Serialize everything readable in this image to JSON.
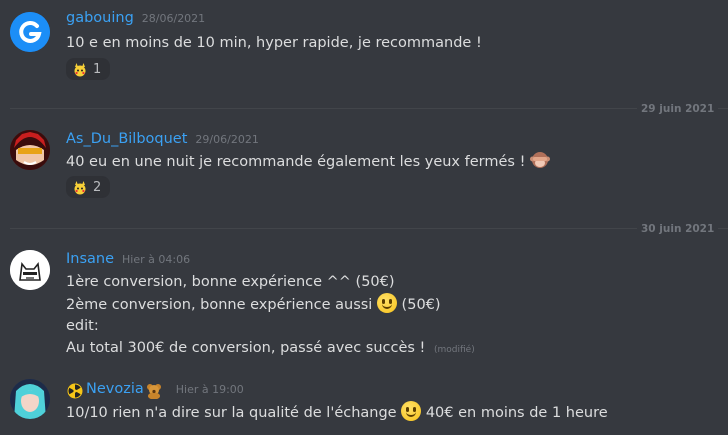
{
  "messages": [
    {
      "username": "gabouing",
      "timestamp": "28/06/2021",
      "user_color": "#3ba1f3",
      "lines": [
        "10 e en moins de 10 min, hyper rapide, je recommande !"
      ],
      "reaction": {
        "emoji": "pikachu-icon",
        "count": "1"
      }
    },
    {
      "username": "As_Du_Bilboquet",
      "timestamp": "29/06/2021",
      "user_color": "#3ba1f3",
      "lines": [
        "40 eu en une nuit  je recommande également les yeux fermés !"
      ],
      "reaction": {
        "emoji": "pikachu-icon",
        "count": "2"
      }
    },
    {
      "username": "Insane",
      "timestamp": "Hier à 04:06",
      "user_color": "#3ba1f3",
      "lines": [
        "1ère conversion, bonne expérience ^^ (50€)",
        "2ème conversion, bonne expérience aussi",
        " (50€)",
        "edit:",
        "Au total 300€ de conversion, passé avec succès !"
      ],
      "edited": "(modifié)"
    },
    {
      "username": "Nevozia",
      "timestamp": "Hier à 19:00",
      "user_color": "#3ba1f3",
      "lines": [
        "10/10 rien n'a dire sur la qualité de l'échange",
        " 40€ en moins de 1 heure"
      ]
    }
  ],
  "dividers": [
    "29 juin 2021",
    "30 juin 2021"
  ],
  "colors": {
    "background": "#36393f",
    "username": "#3ba1f3",
    "text": "#dcddde",
    "muted": "#72767d"
  }
}
